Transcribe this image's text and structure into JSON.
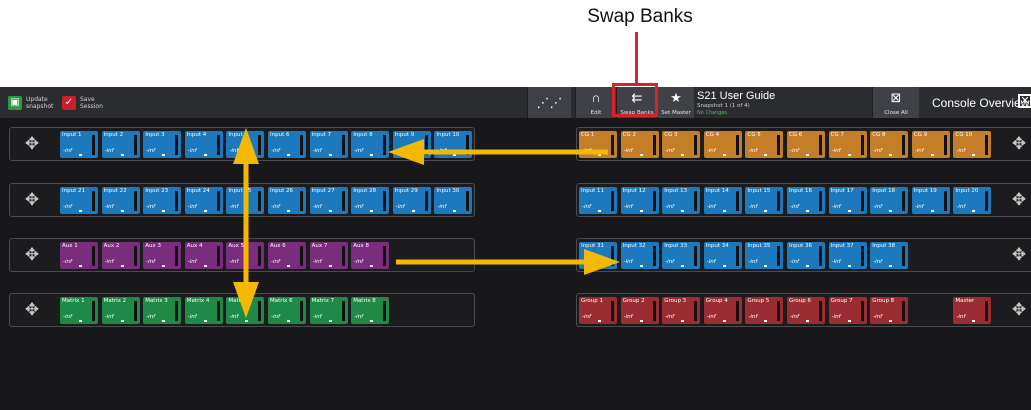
{
  "annotation": {
    "label": "Swap Banks"
  },
  "toolbar": {
    "update_snapshot": "Update\nsnapshot",
    "save_session": "Save\nSession",
    "edit": "Edit",
    "swap_banks": "Swap Banks",
    "set_master": "Set Master",
    "snapshot_title": "S21 User Guide",
    "snapshot_sub": "Snapshot 1 (1 of 4)",
    "snapshot_status": "No Changes",
    "close_all": "Close All",
    "console_overview": "Console Overview"
  },
  "level": "-inf",
  "left_rows": [
    {
      "color": "blue",
      "strips": [
        "Input 1",
        "Input 2",
        "Input 3",
        "Input 4",
        "Input 5",
        "Input 6",
        "Input 7",
        "Input 8",
        "Input 9",
        "Input 10"
      ]
    },
    {
      "color": "blue",
      "strips": [
        "Input 21",
        "Input 22",
        "Input 23",
        "Input 24",
        "Input 25",
        "Input 26",
        "Input 27",
        "Input 28",
        "Input 29",
        "Input 30"
      ]
    },
    {
      "color": "purple",
      "strips": [
        "Aux 1",
        "Aux 2",
        "Aux 3",
        "Aux 4",
        "Aux 5",
        "Aux 6",
        "Aux 7",
        "Aux 8"
      ]
    },
    {
      "color": "green",
      "strips": [
        "Matrix 1",
        "Matrix 2",
        "Matrix 3",
        "Matrix 4",
        "Matrix 5",
        "Matrix 6",
        "Matrix 7",
        "Matrix 8"
      ]
    }
  ],
  "right_rows": [
    {
      "color": "orange",
      "strips": [
        "CG 1",
        "CG 2",
        "CG 3",
        "CG 4",
        "CG 5",
        "CG 6",
        "CG 7",
        "CG 8",
        "CG 9",
        "CG 10"
      ]
    },
    {
      "color": "blue",
      "strips": [
        "Input 11",
        "Input 12",
        "Input 13",
        "Input 14",
        "Input 15",
        "Input 16",
        "Input 17",
        "Input 18",
        "Input 19",
        "Input 20"
      ]
    },
    {
      "color": "blue",
      "strips": [
        "Input 31",
        "Input 32",
        "Input 33",
        "Input 34",
        "Input 35",
        "Input 36",
        "Input 37",
        "Input 38"
      ]
    },
    {
      "color": "red",
      "strips": [
        "Group 1",
        "Group 2",
        "Group 3",
        "Group 4",
        "Group 5",
        "Group 6",
        "Group 7",
        "Group 8",
        "",
        "Master"
      ]
    }
  ],
  "colors": {
    "highlight": "#d8202e",
    "arrow": "#f5b800"
  }
}
